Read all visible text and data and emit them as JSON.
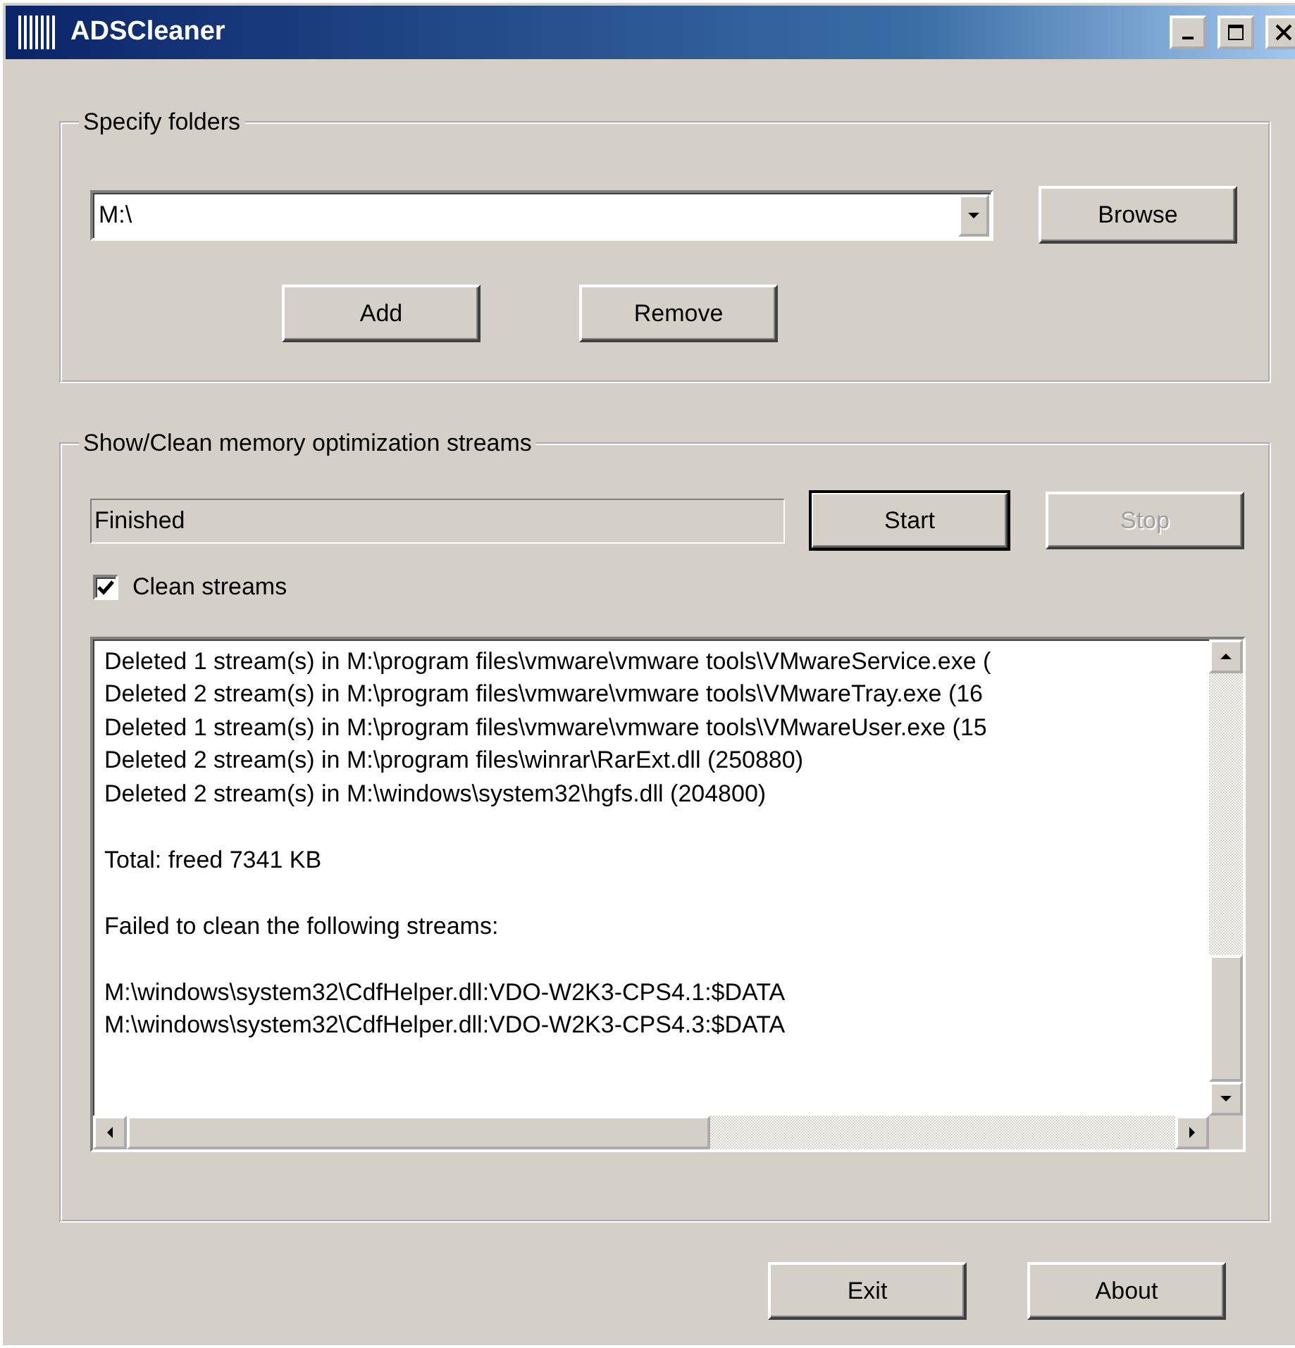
{
  "window": {
    "title": "ADSCleaner"
  },
  "folders_group": {
    "title": "Specify folders",
    "folder_combo": {
      "value": "M:\\"
    },
    "buttons": [
      {
        "label": "Browse",
        "disabled": false,
        "default": false
      },
      {
        "label": "Add",
        "disabled": false,
        "default": false
      },
      {
        "label": "Remove",
        "disabled": false,
        "default": false
      }
    ]
  },
  "streams_group": {
    "title": "Show/Clean memory optimization streams",
    "status": "Finished",
    "buttons": [
      {
        "label": "Start",
        "disabled": false,
        "default": true
      },
      {
        "label": "Stop",
        "disabled": true,
        "default": false
      }
    ],
    "clean_streams": {
      "label": "Clean streams",
      "checked": true
    },
    "log": [
      [
        "Deleted 1 stream(s) in M:\\program files\\vmware\\vmware tools\\VMwareService.exe (",
        "Deleted 2 stream(s) in M:\\program files\\vmware\\vmware tools\\VMwareTray.exe (16",
        "Deleted 1 stream(s) in M:\\program files\\vmware\\vmware tools\\VMwareUser.exe (15",
        "Deleted 2 stream(s) in M:\\program files\\winrar\\RarExt.dll (250880)",
        "Deleted 2 stream(s) in M:\\windows\\system32\\hgfs.dll (204800)"
      ],
      [
        "Total: freed 7341 KB"
      ],
      [
        "Failed to clean the following streams:"
      ],
      [
        "M:\\windows\\system32\\CdfHelper.dll:VDO-W2K3-CPS4.1:$DATA",
        "M:\\windows\\system32\\CdfHelper.dll:VDO-W2K3-CPS4.3:$DATA"
      ]
    ]
  },
  "footer_buttons": [
    {
      "label": "Exit",
      "disabled": false,
      "default": false
    },
    {
      "label": "About",
      "disabled": false,
      "default": false
    }
  ]
}
